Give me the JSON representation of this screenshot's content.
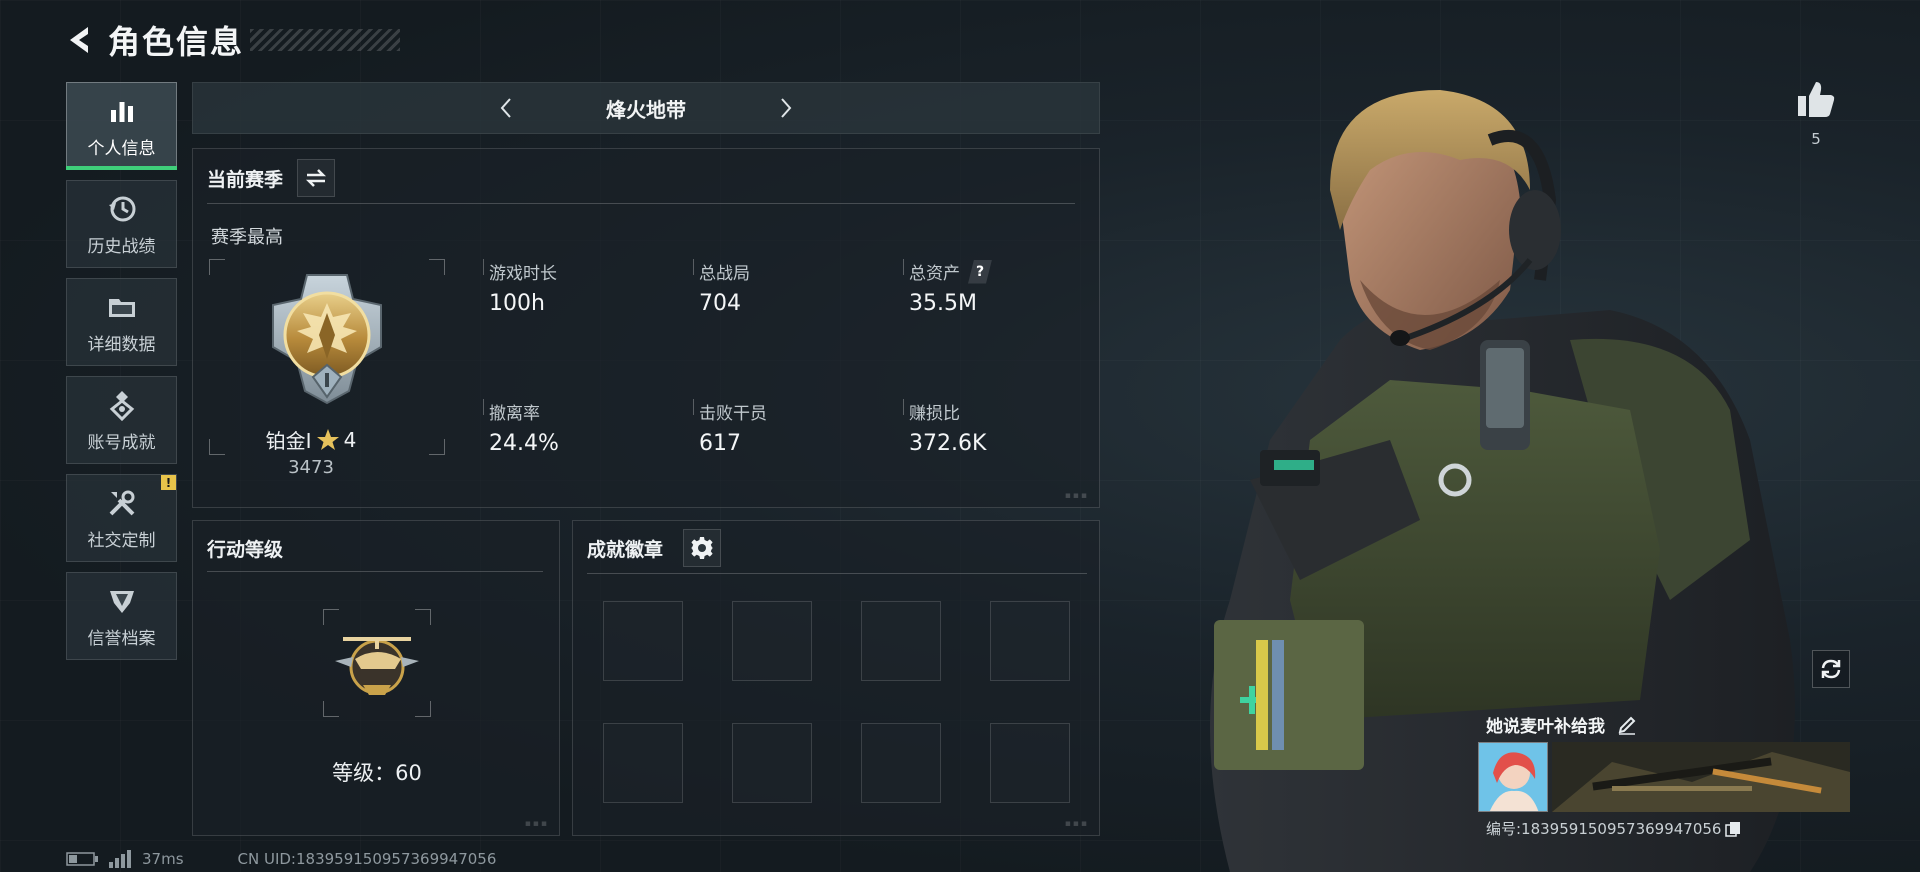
{
  "header": {
    "title": "角色信息",
    "back_icon": "back-arrow-icon"
  },
  "sidebar": {
    "items": [
      {
        "label": "个人信息",
        "icon": "bar-chart-icon",
        "active": true
      },
      {
        "label": "历史战绩",
        "icon": "history-clock-icon"
      },
      {
        "label": "详细数据",
        "icon": "folder-icon"
      },
      {
        "label": "账号成就",
        "icon": "achievement-icon"
      },
      {
        "label": "社交定制",
        "icon": "tools-icon",
        "alert": "!"
      },
      {
        "label": "信誉档案",
        "icon": "credit-shield-icon"
      }
    ]
  },
  "mode": {
    "name": "烽火地带"
  },
  "season": {
    "title": "当前赛季",
    "subtitle": "赛季最高",
    "rank": {
      "name": "铂金Ⅰ",
      "stars": "4",
      "score": "3473"
    },
    "stats": [
      {
        "label": "游戏时长",
        "value": "100h"
      },
      {
        "label": "总战局",
        "value": "704"
      },
      {
        "label": "总资产",
        "value": "35.5M",
        "help": "?"
      },
      {
        "label": "撤离率",
        "value": "24.4%"
      },
      {
        "label": "击败干员",
        "value": "617"
      },
      {
        "label": "赚损比",
        "value": "372.6K"
      }
    ]
  },
  "action_level": {
    "title": "行动等级",
    "level_text": "等级：60"
  },
  "achievements": {
    "title": "成就徽章",
    "slot_count": 8
  },
  "likes": {
    "count": "5"
  },
  "card": {
    "name": "她说麦叶补给我",
    "id_text": "编号:1839591509573699470​56"
  },
  "status": {
    "latency": "37ms",
    "uid": "CN UID:1839591509573699470​56"
  },
  "colors": {
    "accent_green": "#3fcf7a",
    "alert_yellow": "#e8c44a",
    "rank_gold": "#c9a24a"
  }
}
